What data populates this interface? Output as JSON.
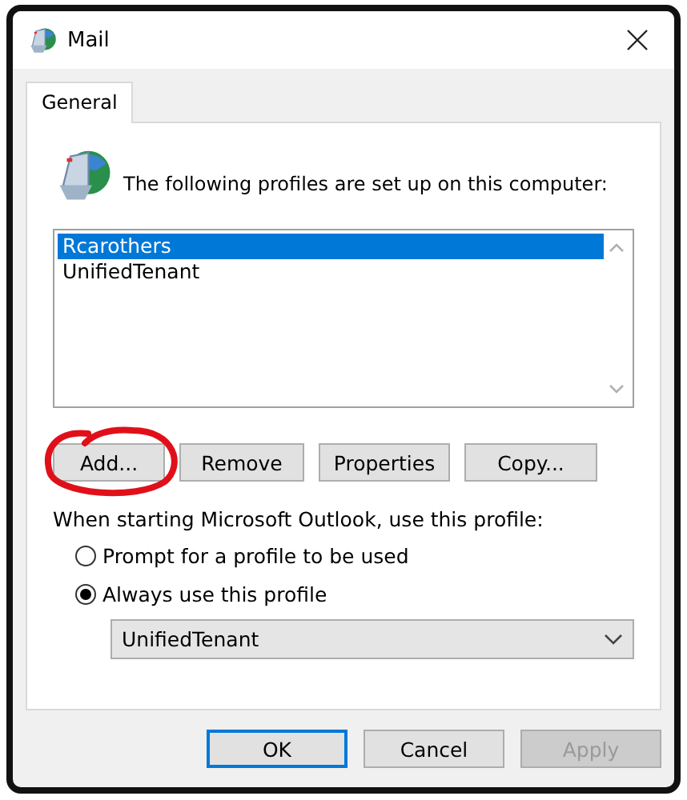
{
  "window": {
    "title": "Mail"
  },
  "tabs": [
    {
      "label": "General",
      "selected": true
    }
  ],
  "heading": "The following profiles are set up on this computer:",
  "profiles": [
    {
      "name": "Rcarothers",
      "selected": true
    },
    {
      "name": "UnifiedTenant",
      "selected": false
    }
  ],
  "profile_buttons": [
    {
      "label": "Add...",
      "circled": true
    },
    {
      "label": "Remove",
      "circled": false
    },
    {
      "label": "Properties",
      "circled": false
    },
    {
      "label": "Copy...",
      "circled": false
    }
  ],
  "startup": {
    "label": "When starting Microsoft Outlook, use this profile:",
    "options": [
      {
        "label": "Prompt for a profile to be used",
        "selected": false
      },
      {
        "label": "Always use this profile",
        "selected": true
      }
    ],
    "profile_select": {
      "value": "UnifiedTenant"
    }
  },
  "buttons": [
    {
      "label": "OK",
      "default": true,
      "disabled": false
    },
    {
      "label": "Cancel",
      "default": false,
      "disabled": false
    },
    {
      "label": "Apply",
      "default": false,
      "disabled": true
    }
  ]
}
